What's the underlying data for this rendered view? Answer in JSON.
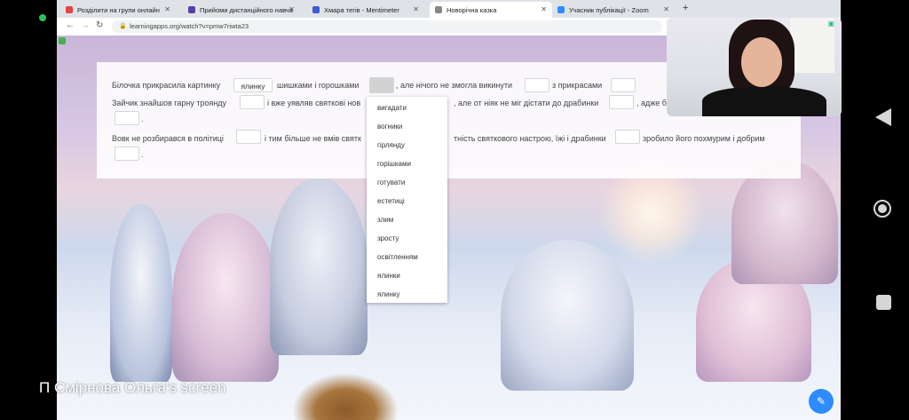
{
  "tabs": [
    {
      "label": "Розділити на групи онлайн",
      "color": "#e8453c"
    },
    {
      "label": "Прийоми дистанційного навча",
      "color": "#5b3fa8"
    },
    {
      "label": "Хмара тегів - Mentimeter",
      "color": "#3e5bd6"
    },
    {
      "label": "Новорічна казка",
      "color": "#888888",
      "active": true
    },
    {
      "label": "Учасник публікації - Zoom",
      "color": "#2d8cff"
    }
  ],
  "address": "learningapps.org/watch?v=pmw7riwta23",
  "exercise": {
    "line1": {
      "t1": "Білочка прикрасила картинку",
      "b1": "ялинку",
      "t2": "шишками і горошками",
      "t3": ", але нічого не змогла викинути",
      "t4": "з прикрасами"
    },
    "line2": {
      "t1": "Зайчик знайшов гарну троянду",
      "t2": "і вже уявляв святкові нов",
      "t3": ", але от ніяк не міг дістати до драбинки",
      "t4": ", адже б"
    },
    "line3": {
      "t5": "."
    },
    "line4": {
      "t1": "Вовк не розбирався в політиці",
      "t2": "і тим більше не вмів святк",
      "t3": "тність святкового настрою, їжі і драбинки",
      "t4": "зробило його похмурим і добрим"
    },
    "line5": {
      "t5": "."
    }
  },
  "dropdown_options": [
    "вигадати",
    "вогники",
    "гірлянду",
    "горішками",
    "готувати",
    "естетиці",
    "злим",
    "зросту",
    "освітленням",
    "ялинки",
    "ялинку"
  ],
  "screen_share_label": "П Смірнова Ольга's screen"
}
